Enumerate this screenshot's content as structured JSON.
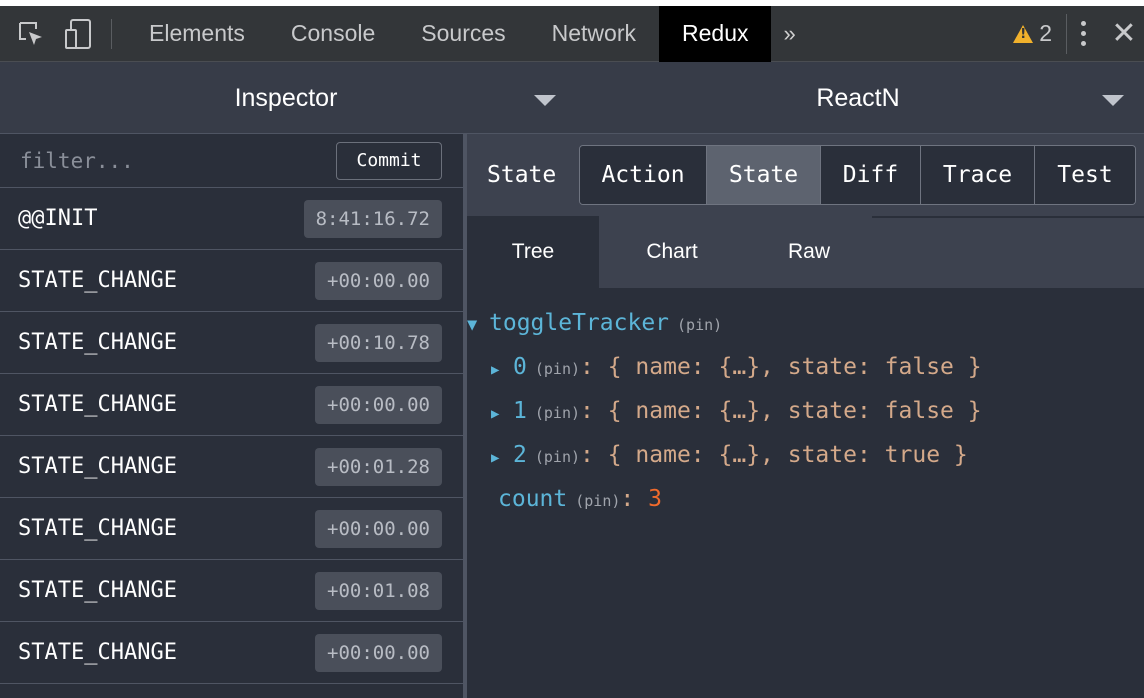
{
  "devtools": {
    "tabs": [
      "Elements",
      "Console",
      "Sources",
      "Network",
      "Redux"
    ],
    "active_tab": "Redux",
    "more_label": "»",
    "warning_count": "2"
  },
  "header": {
    "monitor_select": "Inspector",
    "instance_select": "ReactN"
  },
  "actions": {
    "filter_placeholder": "filter...",
    "commit_label": "Commit",
    "items": [
      {
        "name": "@@INIT",
        "time": "8:41:16.72"
      },
      {
        "name": "STATE_CHANGE",
        "time": "+00:00.00"
      },
      {
        "name": "STATE_CHANGE",
        "time": "+00:10.78"
      },
      {
        "name": "STATE_CHANGE",
        "time": "+00:00.00"
      },
      {
        "name": "STATE_CHANGE",
        "time": "+00:01.28"
      },
      {
        "name": "STATE_CHANGE",
        "time": "+00:00.00"
      },
      {
        "name": "STATE_CHANGE",
        "time": "+00:01.08"
      },
      {
        "name": "STATE_CHANGE",
        "time": "+00:00.00"
      }
    ]
  },
  "inspector": {
    "title": "State",
    "tabs": [
      "Action",
      "State",
      "Diff",
      "Trace",
      "Test"
    ],
    "active_tab": "State",
    "subtabs": [
      "Tree",
      "Chart",
      "Raw"
    ],
    "active_subtab": "Tree",
    "tree": {
      "root_key": "toggleTracker",
      "pin": "(pin)",
      "items": [
        {
          "key": "0",
          "value": "{ name: {…}, state: false }"
        },
        {
          "key": "1",
          "value": "{ name: {…}, state: false }"
        },
        {
          "key": "2",
          "value": "{ name: {…}, state: true }"
        }
      ],
      "count_key": "count",
      "count_value": "3"
    }
  }
}
